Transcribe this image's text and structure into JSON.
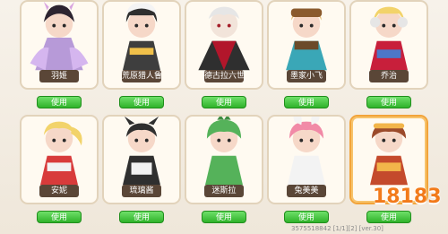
{
  "characters": [
    {
      "name": "羽姬",
      "button": "使用"
    },
    {
      "name": "荒原猎人鲁诺",
      "button": "使用"
    },
    {
      "name": "德古拉六世",
      "button": "使用"
    },
    {
      "name": "墨家小飞",
      "button": "使用"
    },
    {
      "name": "乔治",
      "button": "使用"
    },
    {
      "name": "安妮",
      "button": "使用"
    },
    {
      "name": "琉璃酱",
      "button": "使用"
    },
    {
      "name": "迷斯拉",
      "button": "使用"
    },
    {
      "name": "兔美美",
      "button": "使用"
    },
    {
      "name": "",
      "button": "使用"
    }
  ],
  "watermark": {
    "text": "18183"
  },
  "footer": {
    "text": "3575518842  [1/1][2]  [ver.30]"
  },
  "colors": {
    "button_green": "#2fb22a",
    "name_bg": "#5a4637",
    "card_bg": "#fffaf1",
    "selected": "#f2a43a"
  }
}
